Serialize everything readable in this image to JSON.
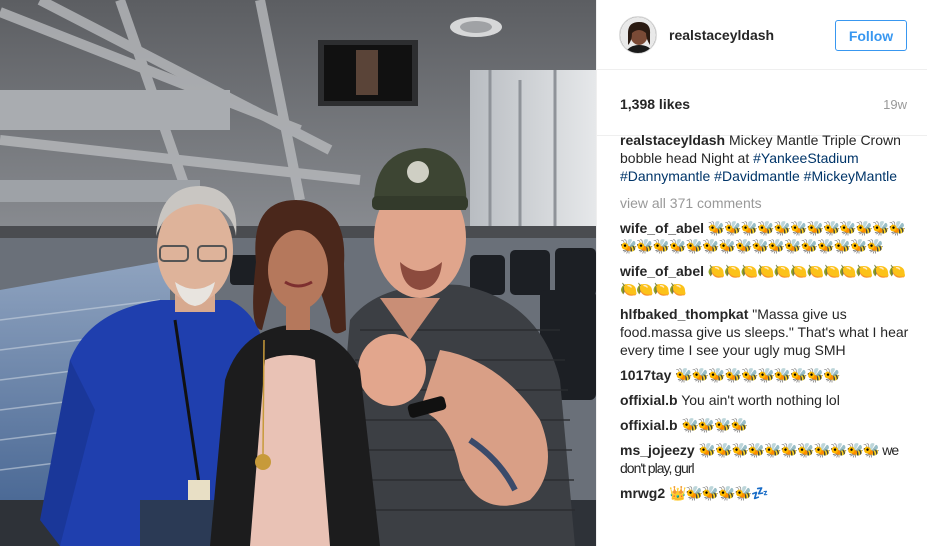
{
  "post": {
    "username": "realstaceyldash",
    "follow_label": "Follow",
    "likes": "1,398 likes",
    "time": "19w",
    "caption": {
      "user": "realstaceyldash",
      "text": "Mickey Mantle Triple Crown bobble head Night at",
      "tags": [
        "#YankeeStadium",
        "#Dannymantle",
        "#Davidmantle",
        "#MickeyMantle"
      ]
    },
    "view_all": "view all 371 comments",
    "comments": [
      {
        "user": "wife_of_abel",
        "text": "🐝🐝🐝🐝🐝🐝🐝🐝🐝🐝🐝🐝🐝🐝🐝🐝🐝🐝🐝🐝🐝🐝🐝🐝🐝🐝🐝🐝"
      },
      {
        "user": "wife_of_abel",
        "text": "🍋🍋🍋🍋🍋🍋🍋🍋🍋🍋🍋🍋🍋🍋🍋🍋"
      },
      {
        "user": "hlfbaked_thompkat",
        "text": "\"Massa give us food.massa give us sleeps.\" That's what I hear every time I see your ugly mug SMH"
      },
      {
        "user": "1017tay",
        "text": "🐝🐝🐝🐝🐝🐝🐝🐝🐝🐝"
      },
      {
        "user": "offixial.b",
        "text": "You ain't worth nothing lol"
      },
      {
        "user": "offixial.b",
        "text": "🐝🐝🐝🐝"
      },
      {
        "user": "ms_jojeezy",
        "text": "🐝🐝🐝🐝🐝🐝🐝🐝🐝🐝🐝 we don't play, gurl"
      },
      {
        "user": "mrwg2",
        "text": "👑🐝🐝🐝🐝💤"
      }
    ]
  },
  "colors": {
    "accent": "#3897f0",
    "hashtag": "#003569",
    "muted": "#999999",
    "text": "#262626"
  },
  "icons": {
    "avatar": "profile-photo",
    "photo": "stadium-suite-photo"
  }
}
